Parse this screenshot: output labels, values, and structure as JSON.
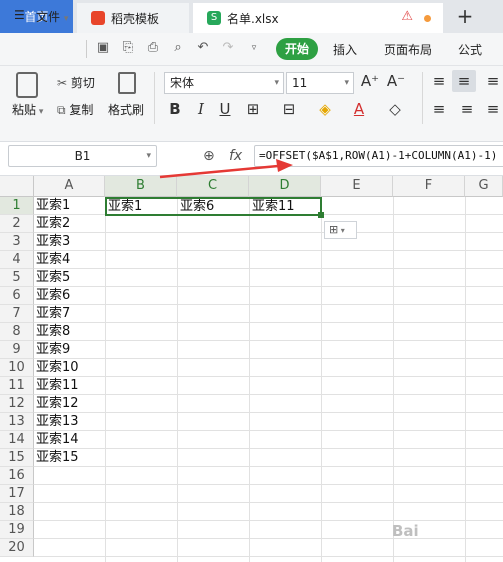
{
  "tabs": {
    "home": "首页",
    "template": "稻壳模板",
    "file": "名单.xlsx",
    "file_icon_letter": "S",
    "add": "+"
  },
  "menu": {
    "file_label": "文件",
    "start": "开始",
    "insert": "插入",
    "page_layout": "页面布局",
    "formula": "公式"
  },
  "ribbon": {
    "paste": "粘贴",
    "cut": "剪切",
    "copy": "复制",
    "format_painter": "格式刷",
    "font_name": "宋体",
    "font_size": "11",
    "bold": "B",
    "italic": "I",
    "underline": "U",
    "grow_font": "A⁺",
    "shrink_font": "A⁻"
  },
  "formula_bar": {
    "name_box": "B1",
    "fx": "fx",
    "formula": "=OFFSET($A$1,ROW(A1)-1+COLUMN(A1)-1)"
  },
  "columns": [
    "A",
    "B",
    "C",
    "D",
    "E",
    "F",
    "G"
  ],
  "rows": [
    "1",
    "2",
    "3",
    "4",
    "5",
    "6",
    "7",
    "8",
    "9",
    "10",
    "11",
    "12",
    "13",
    "14",
    "15",
    "16",
    "17",
    "18",
    "19",
    "20"
  ],
  "column_a": [
    "亚索1",
    "亚索2",
    "亚索3",
    "亚索4",
    "亚索5",
    "亚索6",
    "亚索7",
    "亚索8",
    "亚索9",
    "亚索10",
    "亚索11",
    "亚索12",
    "亚索13",
    "亚索14",
    "亚索15"
  ],
  "row1": {
    "b": "亚索1",
    "c": "亚索6",
    "d": "亚索11"
  },
  "watermark": "Bai",
  "colors": {
    "accent_green": "#2ea043",
    "home_tab_blue": "#3d79d9",
    "selection": "#2e7d32",
    "arrow": "#e53935"
  }
}
